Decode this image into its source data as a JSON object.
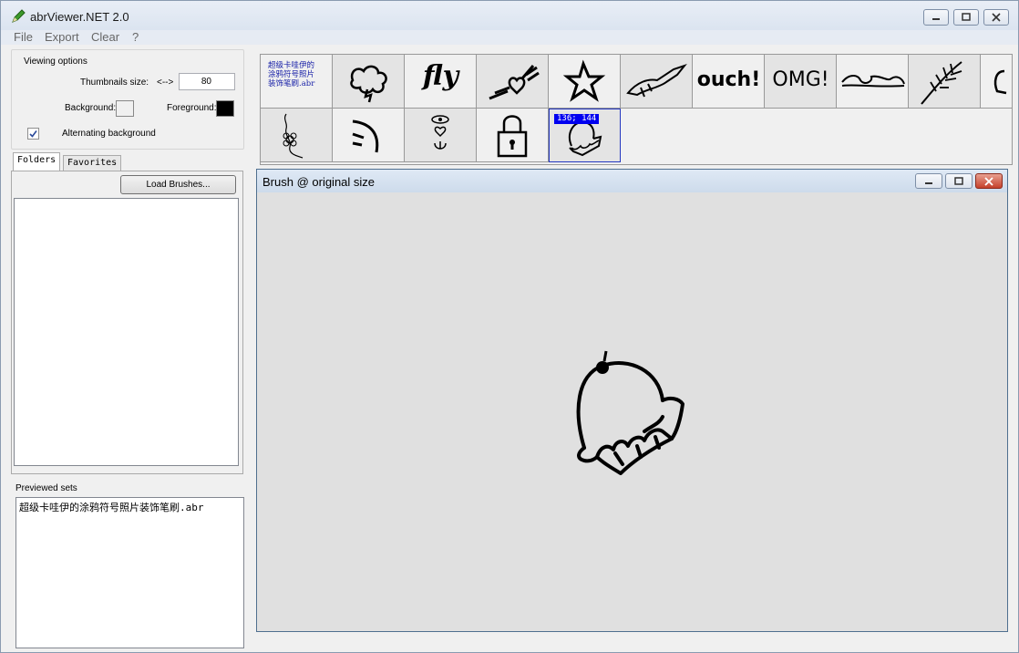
{
  "app": {
    "title": "abrViewer.NET 2.0"
  },
  "menu": [
    "File",
    "Export",
    "Clear",
    "?"
  ],
  "viewing_options": {
    "legend": "Viewing options",
    "thumb_label": "Thumbnails size:",
    "arrow": "<-->",
    "thumb_value": "80",
    "background_label": "Background:",
    "background_color": "#f0f0f0",
    "foreground_label": "Foreground:",
    "foreground_color": "#000000",
    "alternating_label": "Alternating background",
    "alternating_checked": true
  },
  "tabs": [
    {
      "label": "Folders",
      "active": true
    },
    {
      "label": "Favorites",
      "active": false
    }
  ],
  "load_button": "Load Brushes...",
  "previewed": {
    "label": "Previewed sets",
    "items": [
      "超级卡哇伊的涂鸦符号照片装饰笔刷.abr"
    ]
  },
  "thumbnails": [
    {
      "text": "超级卡哇伊的\n涂鸦符号照片\n装饰笔刷.abr",
      "icon": "set-name-text"
    },
    {
      "icon": "cloud-icon"
    },
    {
      "word": "fly",
      "icon": "fly-word"
    },
    {
      "icon": "winged-heart-icon"
    },
    {
      "icon": "star-icon"
    },
    {
      "icon": "flying-creature-icon"
    },
    {
      "word": "ouch!",
      "icon": "ouch-word"
    },
    {
      "word": "OMG!",
      "icon": "omg-word"
    },
    {
      "icon": "wave-icon"
    },
    {
      "icon": "feather-icon"
    },
    {
      "icon": "partial-icon"
    },
    {
      "icon": "flower-icon"
    },
    {
      "icon": "smile-icon"
    },
    {
      "icon": "eye-heart-icon"
    },
    {
      "icon": "padlock-icon"
    },
    {
      "icon": "cupcake-icon",
      "coord": "136; 144",
      "selected": true
    }
  ],
  "preview_window": {
    "title": "Brush @ original size"
  }
}
